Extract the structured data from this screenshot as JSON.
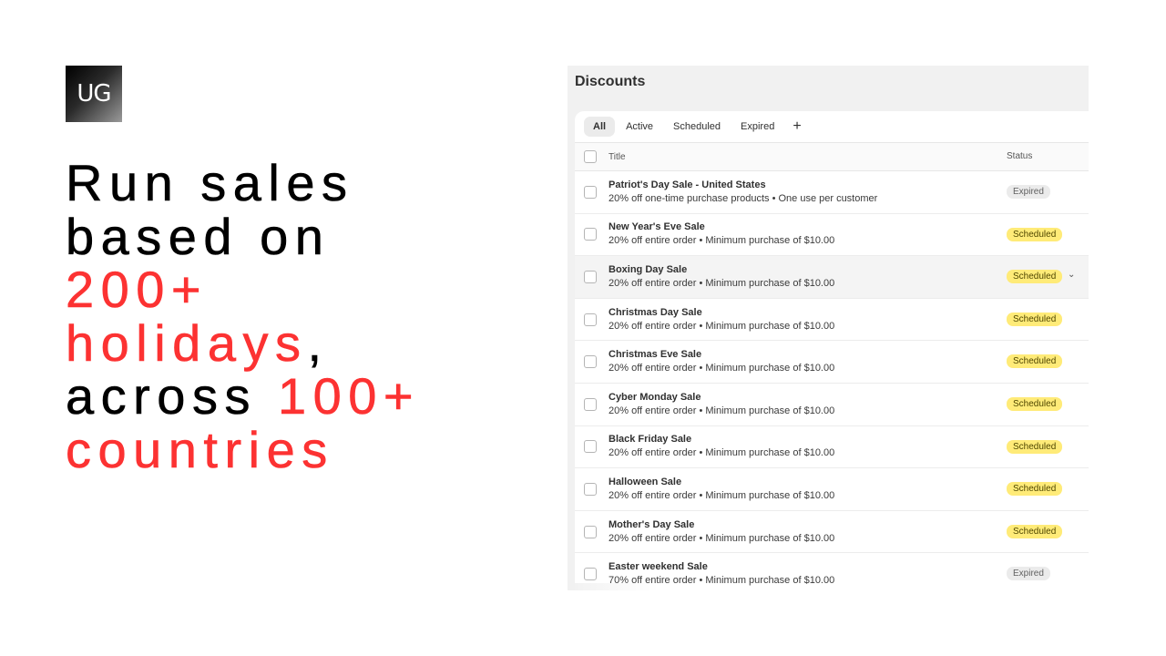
{
  "logo": {
    "text": "UG"
  },
  "headline": {
    "line1": "Run sales",
    "line2": "based on",
    "line3": "200+",
    "line4_red": "holidays",
    "line4_black": ",",
    "line5_black": "across ",
    "line5_red": "100+",
    "line6": "countries",
    "accent_color": "#fc3232"
  },
  "discounts": {
    "title": "Discounts",
    "tabs": [
      {
        "label": "All",
        "active": true
      },
      {
        "label": "Active",
        "active": false
      },
      {
        "label": "Scheduled",
        "active": false
      },
      {
        "label": "Expired",
        "active": false
      }
    ],
    "add_tab_label": "+",
    "columns": {
      "title": "Title",
      "status": "Status"
    },
    "rows": [
      {
        "title": "Patriot's Day Sale - United States",
        "desc": "20% off one-time purchase products • One use per customer",
        "status": "Expired"
      },
      {
        "title": "New Year's Eve Sale",
        "desc": "20% off entire order • Minimum purchase of $10.00",
        "status": "Scheduled"
      },
      {
        "title": "Boxing Day Sale",
        "desc": "20% off entire order • Minimum purchase of $10.00",
        "status": "Scheduled"
      },
      {
        "title": "Christmas Day Sale",
        "desc": "20% off entire order • Minimum purchase of $10.00",
        "status": "Scheduled"
      },
      {
        "title": "Christmas Eve Sale",
        "desc": "20% off entire order • Minimum purchase of $10.00",
        "status": "Scheduled"
      },
      {
        "title": "Cyber Monday Sale",
        "desc": "20% off entire order • Minimum purchase of $10.00",
        "status": "Scheduled"
      },
      {
        "title": "Black Friday Sale",
        "desc": "20% off entire order • Minimum purchase of $10.00",
        "status": "Scheduled"
      },
      {
        "title": "Halloween Sale",
        "desc": "20% off entire order • Minimum purchase of $10.00",
        "status": "Scheduled"
      },
      {
        "title": "Mother's Day Sale",
        "desc": "20% off entire order • Minimum purchase of $10.00",
        "status": "Scheduled"
      },
      {
        "title": "Easter weekend Sale",
        "desc": "70% off entire order • Minimum purchase of $10.00",
        "status": "Expired"
      }
    ],
    "chevron_icon": "chevron-down-icon"
  }
}
